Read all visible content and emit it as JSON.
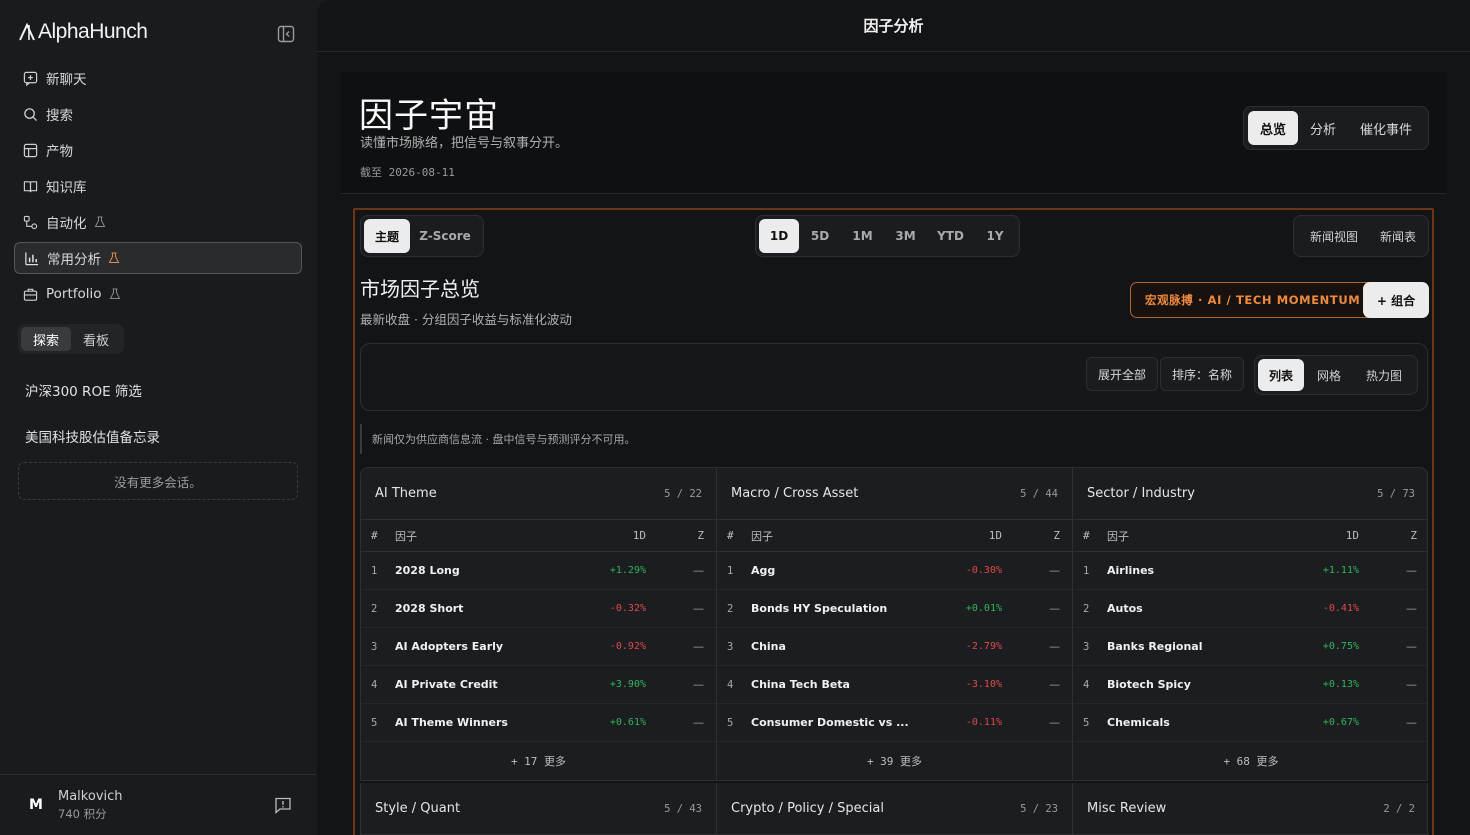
{
  "app": {
    "name": "AlphaHunch"
  },
  "sidebar": {
    "nav": [
      {
        "label": "新聊天",
        "icon": "new-chat-icon"
      },
      {
        "label": "搜索",
        "icon": "search-icon"
      },
      {
        "label": "产物",
        "icon": "layout-icon"
      },
      {
        "label": "知识库",
        "icon": "book-icon"
      },
      {
        "label": "自动化",
        "icon": "workflow-icon",
        "beta": true
      },
      {
        "label": "常用分析",
        "icon": "bar-chart-icon",
        "beta": true,
        "active": true
      },
      {
        "label": "Portfolio",
        "icon": "briefcase-icon",
        "beta": true
      }
    ],
    "tabs": [
      "探索",
      "看板"
    ],
    "conversations": [
      "沪深300 ROE 筛选",
      "美国科技股估值备忘录"
    ],
    "no_more": "没有更多会话。",
    "user": {
      "initial": "M",
      "name": "Malkovich",
      "points": "740 积分"
    }
  },
  "main": {
    "title": "因子分析",
    "hero": {
      "title": "因子宇宙",
      "subtitle": "读懂市场脉络，把信号与叙事分开。",
      "as_of": "截至 2026-08-11",
      "tabs": [
        "总览",
        "分析",
        "催化事件"
      ]
    },
    "panel": {
      "mode_tabs": [
        "主题",
        "Z-Score"
      ],
      "period_tabs": [
        "1D",
        "5D",
        "1M",
        "3M",
        "YTD",
        "1Y"
      ],
      "news_tabs": [
        "新闻视图",
        "新闻表"
      ],
      "title": "市场因子总览",
      "subtitle": "最新收盘 · 分组因子收益与标准化波动",
      "macro_button": "宏观脉搏 · AI / TECH MOMENTUM",
      "combo_button": "+ 组合",
      "expand_all": "展开全部",
      "sort": "排序：名称",
      "view_tabs": [
        "列表",
        "网格",
        "热力图"
      ],
      "notice": "新闻仅为供应商信息流 · 盘中信号与预测评分不可用。",
      "columns": {
        "idx": "#",
        "factor": "因子",
        "ret": "1D",
        "z": "Z"
      },
      "groups": [
        {
          "name": "AI Theme",
          "count": "5 / 22",
          "rows": [
            {
              "idx": "1",
              "name": "2028 Long",
              "ret": "+1.29%",
              "dir": "pos",
              "z": "—"
            },
            {
              "idx": "2",
              "name": "2028 Short",
              "ret": "-0.32%",
              "dir": "neg",
              "z": "—"
            },
            {
              "idx": "3",
              "name": "AI Adopters Early",
              "ret": "-0.92%",
              "dir": "neg",
              "z": "—"
            },
            {
              "idx": "4",
              "name": "AI Private Credit",
              "ret": "+3.90%",
              "dir": "pos",
              "z": "—"
            },
            {
              "idx": "5",
              "name": "AI Theme Winners",
              "ret": "+0.61%",
              "dir": "pos",
              "z": "—"
            }
          ],
          "more": "+ 17 更多"
        },
        {
          "name": "Macro / Cross Asset",
          "count": "5 / 44",
          "rows": [
            {
              "idx": "1",
              "name": "Agg",
              "ret": "-0.30%",
              "dir": "neg",
              "z": "—"
            },
            {
              "idx": "2",
              "name": "Bonds HY Speculation",
              "ret": "+0.01%",
              "dir": "pos",
              "z": "—"
            },
            {
              "idx": "3",
              "name": "China",
              "ret": "-2.79%",
              "dir": "neg",
              "z": "—"
            },
            {
              "idx": "4",
              "name": "China Tech Beta",
              "ret": "-3.10%",
              "dir": "neg",
              "z": "—"
            },
            {
              "idx": "5",
              "name": "Consumer Domestic vs ...",
              "ret": "-0.11%",
              "dir": "neg",
              "z": "—"
            }
          ],
          "more": "+ 39 更多"
        },
        {
          "name": "Sector / Industry",
          "count": "5 / 73",
          "rows": [
            {
              "idx": "1",
              "name": "Airlines",
              "ret": "+1.11%",
              "dir": "pos",
              "z": "—"
            },
            {
              "idx": "2",
              "name": "Autos",
              "ret": "-0.41%",
              "dir": "neg",
              "z": "—"
            },
            {
              "idx": "3",
              "name": "Banks Regional",
              "ret": "+0.75%",
              "dir": "pos",
              "z": "—"
            },
            {
              "idx": "4",
              "name": "Biotech Spicy",
              "ret": "+0.13%",
              "dir": "pos",
              "z": "—"
            },
            {
              "idx": "5",
              "name": "Chemicals",
              "ret": "+0.67%",
              "dir": "pos",
              "z": "—"
            }
          ],
          "more": "+ 68 更多"
        }
      ],
      "groups_row2": [
        {
          "name": "Style / Quant",
          "count": "5 / 43"
        },
        {
          "name": "Crypto / Policy / Special",
          "count": "5 / 23"
        },
        {
          "name": "Misc Review",
          "count": "2 / 2"
        }
      ]
    }
  },
  "colors": {
    "accent": "#f08a3e",
    "positive": "#33b35a",
    "negative": "#e04a48",
    "panel_border": "#6b3516"
  }
}
